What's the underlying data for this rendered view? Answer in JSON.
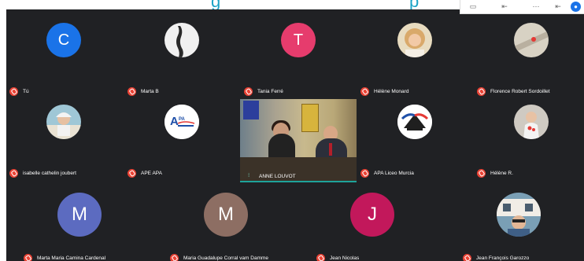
{
  "header": {
    "title_fragment_left": "g",
    "title_fragment_right": "p"
  },
  "colors": {
    "stage_bg": "#202124",
    "mic_muted": "#ea4335",
    "active_speaker_border": "#1ea39b",
    "avatar_c": "#1a73e8",
    "avatar_t": "#e63c6d",
    "avatar_m1": "#5c6bc0",
    "avatar_m2": "#8d6e63",
    "avatar_j": "#c2185b"
  },
  "participants": [
    {
      "name": "Tú",
      "avatar_type": "initial",
      "initial": "C",
      "muted": true
    },
    {
      "name": "Marta B",
      "avatar_type": "photo",
      "muted": true
    },
    {
      "name": "Tania Ferré",
      "avatar_type": "initial",
      "initial": "T",
      "muted": true
    },
    {
      "name": "Hélène Monard",
      "avatar_type": "photo",
      "muted": true
    },
    {
      "name": "Florence Robert Sordoillet",
      "avatar_type": "photo",
      "muted": true
    },
    {
      "name": "isabelle cathelin joubert",
      "avatar_type": "photo",
      "muted": true
    },
    {
      "name": "APE APA",
      "avatar_type": "logo",
      "logo_text": "APA",
      "muted": true
    },
    {
      "name": "ANNE LOUVOT",
      "avatar_type": "video",
      "speaking": true
    },
    {
      "name": "APA Liceo Murcia",
      "avatar_type": "logo",
      "muted": true
    },
    {
      "name": "Hélène R.",
      "avatar_type": "photo",
      "muted": true
    },
    {
      "name": "Marta Maria Camina Cardenal",
      "avatar_type": "initial",
      "initial": "M",
      "muted": true
    },
    {
      "name": "Maria Guadalupe Corral vam Damme",
      "avatar_type": "initial",
      "initial": "M",
      "muted": true
    },
    {
      "name": "Jean Nicolas",
      "avatar_type": "initial",
      "initial": "J",
      "muted": true
    },
    {
      "name": "Jean François Garozzo",
      "avatar_type": "photo",
      "muted": true
    }
  ]
}
